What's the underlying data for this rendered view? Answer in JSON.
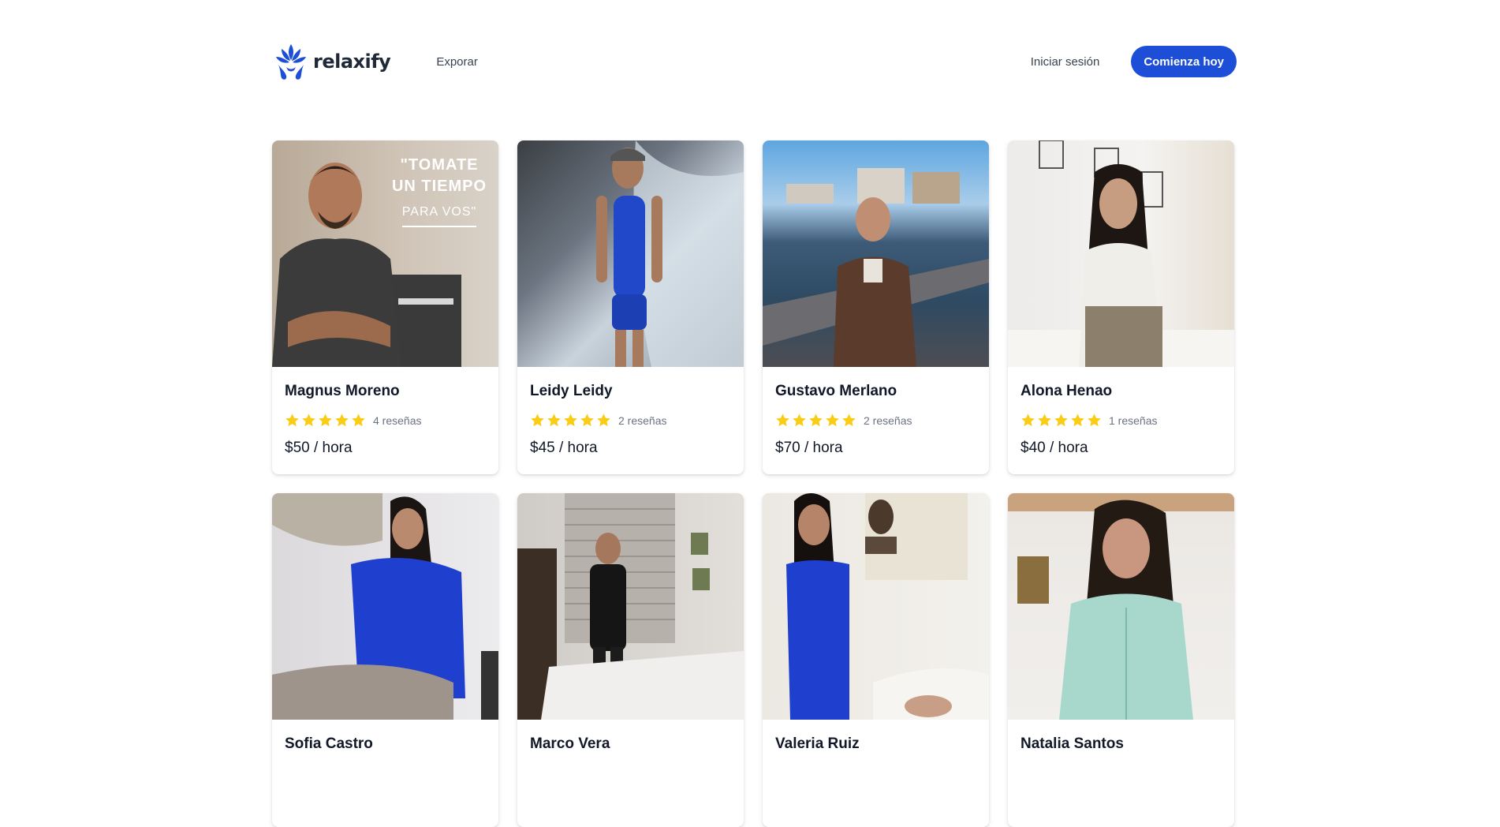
{
  "brand": {
    "name": "relaxify",
    "color": "#1d4ed8"
  },
  "nav": {
    "explore": "Exporar",
    "login": "Iniciar sesión",
    "cta": "Comienza hoy"
  },
  "photo_overlay": {
    "line1": "\"TOMATE",
    "line2": "UN TIEMPO",
    "line3": "PARA VOS\""
  },
  "therapists": [
    {
      "name": "Magnus Moreno",
      "stars": 5,
      "reviews": "4 reseñas",
      "price": "$50 / hora"
    },
    {
      "name": "Leidy Leidy",
      "stars": 5,
      "reviews": "2 reseñas",
      "price": "$45 / hora"
    },
    {
      "name": "Gustavo Merlano",
      "stars": 5,
      "reviews": "2 reseñas",
      "price": "$70 / hora"
    },
    {
      "name": "Alona Henao",
      "stars": 5,
      "reviews": "1 reseñas",
      "price": "$40 / hora"
    },
    {
      "name": "Sofia Castro"
    },
    {
      "name": "Marco Vera"
    },
    {
      "name": "Valeria Ruiz"
    },
    {
      "name": "Natalia Santos"
    }
  ],
  "colors": {
    "star": "#facc15",
    "primary": "#1d4ed8"
  }
}
